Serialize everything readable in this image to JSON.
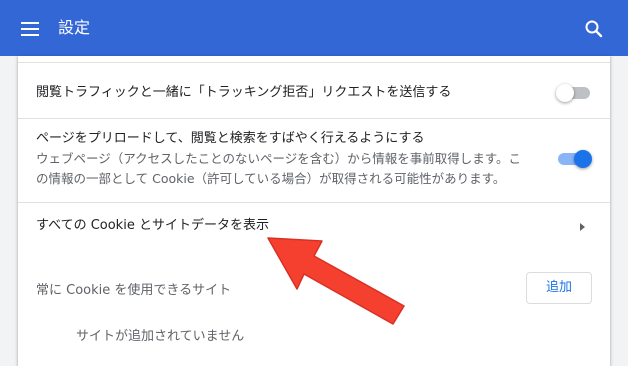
{
  "header": {
    "title": "設定",
    "background": "#3367d6",
    "menu_icon": "hamburger-menu-icon",
    "search_icon": "search-icon"
  },
  "settings": {
    "do_not_track": {
      "label": "閲覧トラフィックと一緒に「トラッキング拒否」リクエストを送信する",
      "enabled": false
    },
    "preload": {
      "label": "ページをプリロードして、閲覧と検索をすばやく行えるようにする",
      "description_line1": "ウェブページ（アクセスしたことのないページを含む）から情報を事前取得します。こ",
      "description_line2": "の情報の一部として Cookie（許可している場合）が取得される可能性があります。",
      "enabled": true
    },
    "all_cookies": {
      "label": "すべての Cookie とサイトデータを表示"
    },
    "always_allow": {
      "label": "常に Cookie を使用できるサイト",
      "add_button": "追加",
      "empty_message": "サイトが追加されていません"
    }
  },
  "accent_color": "#1a73e8",
  "annotation": {
    "type": "red-arrow",
    "color": "#f6402f"
  }
}
